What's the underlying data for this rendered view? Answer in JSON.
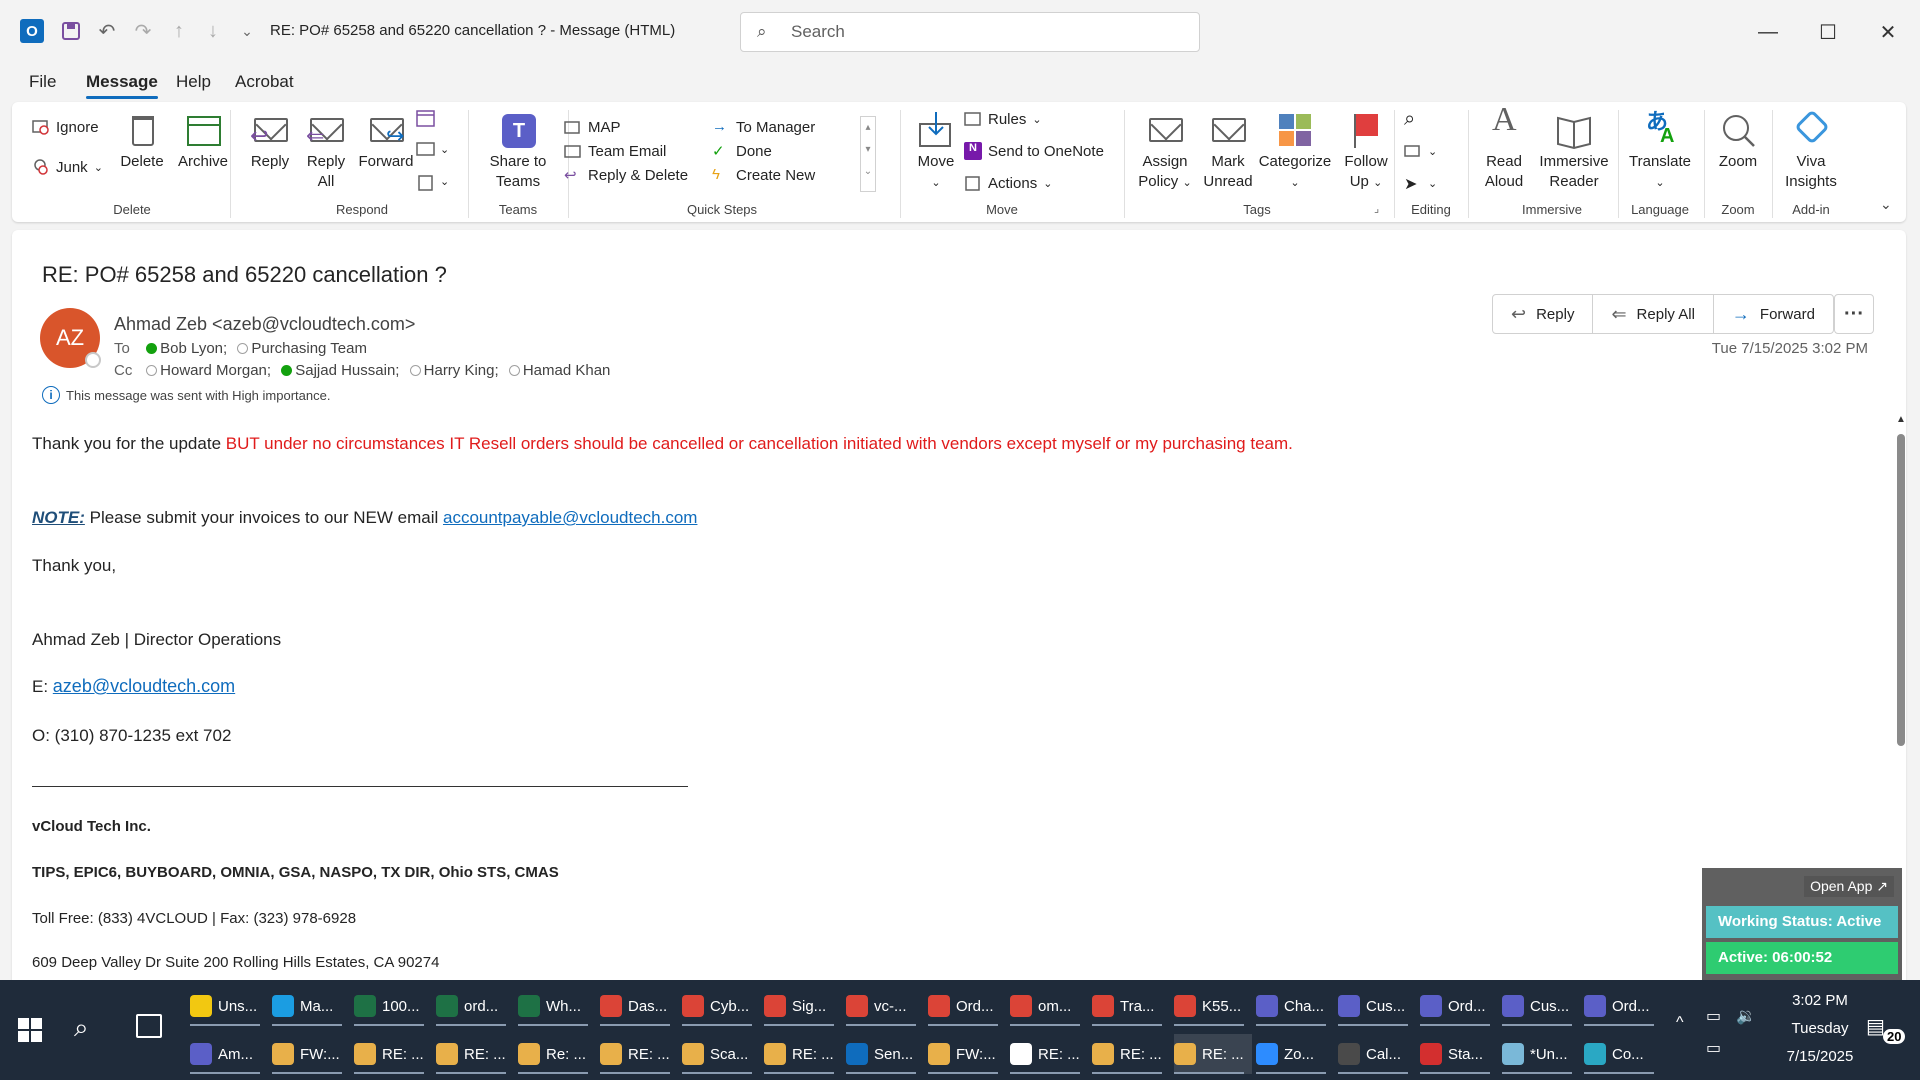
{
  "window": {
    "title": "RE: PO# 65258 and 65220 cancellation ?  -  Message (HTML)",
    "search_placeholder": "Search"
  },
  "menu": [
    "File",
    "Message",
    "Help",
    "Acrobat"
  ],
  "ribbon": {
    "delete_group": {
      "ignore": "Ignore",
      "junk": "Junk",
      "delete": "Delete",
      "archive": "Archive",
      "label": "Delete"
    },
    "respond_group": {
      "reply": "Reply",
      "reply_all_1": "Reply",
      "reply_all_2": "All",
      "forward": "Forward",
      "label": "Respond"
    },
    "teams_group": {
      "share_1": "Share to",
      "share_2": "Teams",
      "label": "Teams"
    },
    "quick_steps": {
      "map": "MAP",
      "team_email": "Team Email",
      "reply_delete": "Reply & Delete",
      "to_manager": "To Manager",
      "done": "Done",
      "create_new": "Create New",
      "label": "Quick Steps"
    },
    "move_group": {
      "move": "Move",
      "rules": "Rules",
      "onenote": "Send to OneNote",
      "actions": "Actions",
      "label": "Move"
    },
    "tags_group": {
      "assign_1": "Assign",
      "assign_2": "Policy",
      "mark_1": "Mark",
      "mark_2": "Unread",
      "categorize": "Categorize",
      "follow_1": "Follow",
      "follow_2": "Up",
      "label": "Tags"
    },
    "editing_label": "Editing",
    "immersive_group": {
      "read_1": "Read",
      "read_2": "Aloud",
      "imm_1": "Immersive",
      "imm_2": "Reader",
      "label": "Immersive"
    },
    "language_group": {
      "translate": "Translate",
      "label": "Language"
    },
    "zoom_group": {
      "zoom": "Zoom",
      "label": "Zoom"
    },
    "addin_group": {
      "viva_1": "Viva",
      "viva_2": "Insights",
      "label": "Add-in"
    }
  },
  "message": {
    "subject": "RE: PO# 65258 and 65220 cancellation ?",
    "avatar_initials": "AZ",
    "sender": "Ahmad Zeb <azeb@vcloudtech.com>",
    "to_label": "To",
    "to": [
      {
        "name": "Bob Lyon;",
        "status": "green"
      },
      {
        "name": "Purchasing Team",
        "status": "empty"
      }
    ],
    "cc_label": "Cc",
    "cc": [
      {
        "name": "Howard Morgan;",
        "status": "empty"
      },
      {
        "name": "Sajjad Hussain;",
        "status": "green"
      },
      {
        "name": "Harry King;",
        "status": "empty"
      },
      {
        "name": "Hamad Khan",
        "status": "empty"
      }
    ],
    "importance_note": "This message was sent with High importance.",
    "actions": {
      "reply": "Reply",
      "reply_all": "Reply All",
      "forward": "Forward"
    },
    "datetime": "Tue 7/15/2025 3:02 PM",
    "body": {
      "line1_normal": "Thank you for the update ",
      "line1_red": "BUT under no circumstances IT Resell orders should be cancelled or cancellation initiated with vendors except myself or my purchasing team.",
      "note_label": "NOTE:",
      "note_text": " Please submit your invoices to our NEW email ",
      "note_email": "accountpayable@vcloudtech.com",
      "thanks": "Thank you,",
      "sig_name": "Ahmad Zeb | Director Operations",
      "email_label": "E:",
      "email": "azeb@vcloudtech.com",
      "phone": "O: (310) 870-1235 ext 702",
      "company": "vCloud Tech Inc.",
      "contracts": "TIPS, EPIC6, BUYBOARD, OMNIA, GSA, NASPO, TX DIR, Ohio STS, CMAS",
      "tollfree": "Toll Free: (833) 4VCLOUD | Fax: (323) 978-6928",
      "address": "609 Deep Valley Dr Suite 200 Rolling Hills Estates, CA 90274"
    }
  },
  "widget": {
    "open_app": "Open App ↗",
    "status": "Working Status: Active",
    "active": "Active: 06:00:52"
  },
  "taskbar": {
    "row1": [
      {
        "label": "Uns...",
        "icon": "notes",
        "color": "#f2c811"
      },
      {
        "label": "Ma...",
        "icon": "edge",
        "color": "#1b9de2"
      },
      {
        "label": "100...",
        "icon": "excel",
        "color": "#1e7145"
      },
      {
        "label": "ord...",
        "icon": "excel",
        "color": "#1e7145"
      },
      {
        "label": "Wh...",
        "icon": "excel",
        "color": "#1e7145"
      },
      {
        "label": "Das...",
        "icon": "chrome",
        "color": "#db4437"
      },
      {
        "label": "Cyb...",
        "icon": "chrome",
        "color": "#db4437"
      },
      {
        "label": "Sig...",
        "icon": "chrome",
        "color": "#db4437"
      },
      {
        "label": "vc-...",
        "icon": "chrome",
        "color": "#db4437"
      },
      {
        "label": "Ord...",
        "icon": "chrome",
        "color": "#db4437"
      },
      {
        "label": "om...",
        "icon": "chrome",
        "color": "#db4437"
      },
      {
        "label": "Tra...",
        "icon": "chrome",
        "color": "#db4437"
      },
      {
        "label": "K55...",
        "icon": "chrome",
        "color": "#db4437"
      },
      {
        "label": "Cha...",
        "icon": "teams",
        "color": "#5b5fc7"
      },
      {
        "label": "Cus...",
        "icon": "teams",
        "color": "#5b5fc7"
      },
      {
        "label": "Ord...",
        "icon": "teams",
        "color": "#5b5fc7"
      },
      {
        "label": "Cus...",
        "icon": "teams",
        "color": "#5b5fc7"
      },
      {
        "label": "Ord...",
        "icon": "teams",
        "color": "#5b5fc7"
      }
    ],
    "row2": [
      {
        "label": "Am...",
        "icon": "teams",
        "color": "#5b5fc7"
      },
      {
        "label": "FW:...",
        "icon": "mail",
        "color": "#e8b04a"
      },
      {
        "label": "RE: ...",
        "icon": "mail",
        "color": "#e8b04a"
      },
      {
        "label": "RE: ...",
        "icon": "mail",
        "color": "#e8b04a"
      },
      {
        "label": "Re: ...",
        "icon": "mail",
        "color": "#e8b04a"
      },
      {
        "label": "RE: ...",
        "icon": "mail",
        "color": "#e8b04a"
      },
      {
        "label": "Sca...",
        "icon": "mail",
        "color": "#e8b04a"
      },
      {
        "label": "RE: ...",
        "icon": "mail",
        "color": "#e8b04a"
      },
      {
        "label": "Sen...",
        "icon": "outlook",
        "color": "#0f6cbd"
      },
      {
        "label": "FW:...",
        "icon": "mail",
        "color": "#e8b04a"
      },
      {
        "label": "RE: ...",
        "icon": "mail",
        "color": "#ffffff"
      },
      {
        "label": "RE: ...",
        "icon": "mail",
        "color": "#e8b04a"
      },
      {
        "label": "RE: ...",
        "icon": "mail",
        "color": "#e8b04a"
      },
      {
        "label": "Zo...",
        "icon": "zoom",
        "color": "#2d8cff"
      },
      {
        "label": "Cal...",
        "icon": "calculator",
        "color": "#4a4a4a"
      },
      {
        "label": "Sta...",
        "icon": "pdf",
        "color": "#d32f2f"
      },
      {
        "label": "*Un...",
        "icon": "notepad",
        "color": "#7ab8d8"
      },
      {
        "label": "Co...",
        "icon": "app",
        "color": "#2aa8c4"
      }
    ],
    "time": "3:02 PM",
    "day": "Tuesday",
    "date": "7/15/2025",
    "notifications": "20"
  }
}
